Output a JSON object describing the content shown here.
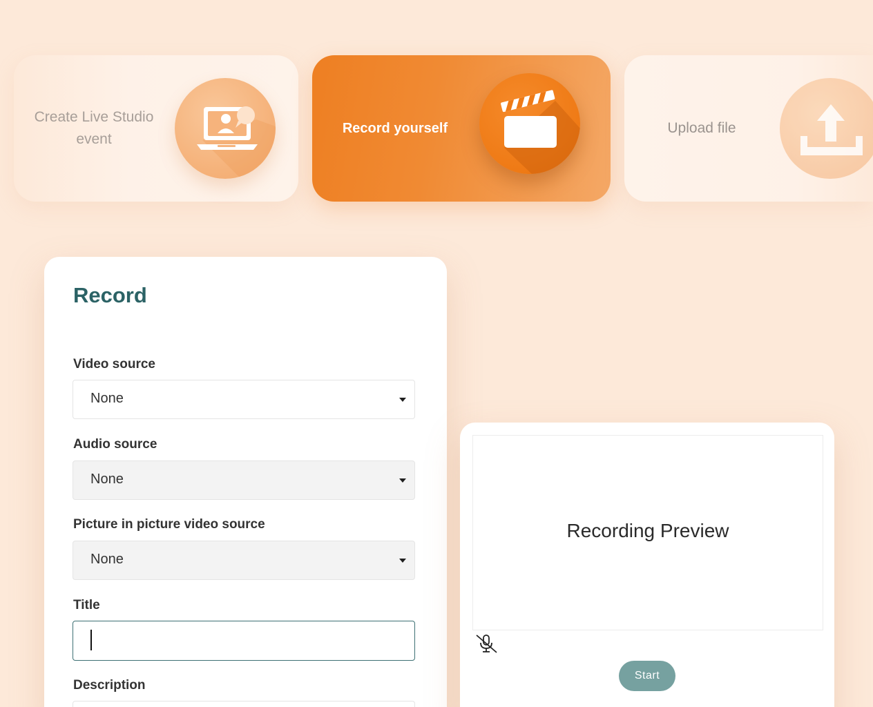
{
  "modes": {
    "live": {
      "label": "Create Live Studio event",
      "icon": "laptop-video-call-icon"
    },
    "record": {
      "label": "Record yourself",
      "icon": "clapperboard-icon"
    },
    "upload": {
      "label": "Upload file",
      "icon": "upload-icon"
    }
  },
  "record_form": {
    "title": "Record",
    "video_source": {
      "label": "Video source",
      "value": "None"
    },
    "audio_source": {
      "label": "Audio source",
      "value": "None"
    },
    "pip_source": {
      "label": "Picture in picture video source",
      "value": "None"
    },
    "title_field": {
      "label": "Title",
      "value": ""
    },
    "description_field": {
      "label": "Description"
    }
  },
  "preview": {
    "text": "Recording Preview",
    "mic_icon": "mic-muted-icon",
    "start_label": "Start"
  },
  "colors": {
    "background": "#fde9d9",
    "accent_orange": "#ee7f22",
    "heading_teal": "#2b6265",
    "start_button": "#76a1a0"
  }
}
